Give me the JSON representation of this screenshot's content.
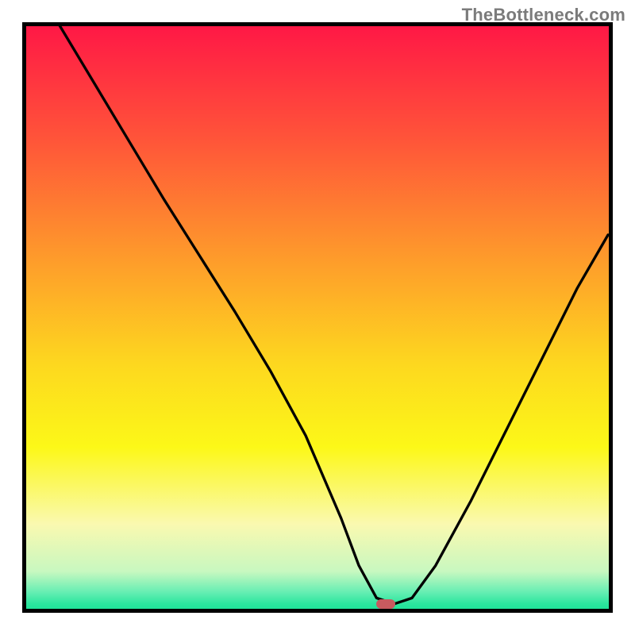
{
  "watermark": {
    "text": "TheBottleneck.com"
  },
  "colors": {
    "frame": "#000000",
    "curve": "#000000",
    "marker": "#c85a5f",
    "gradient_stops": [
      {
        "offset": 0.0,
        "color": "#ff1646"
      },
      {
        "offset": 0.2,
        "color": "#ff5539"
      },
      {
        "offset": 0.4,
        "color": "#fe9b2b"
      },
      {
        "offset": 0.58,
        "color": "#fdd81f"
      },
      {
        "offset": 0.72,
        "color": "#fcf818"
      },
      {
        "offset": 0.85,
        "color": "#faf9b0"
      },
      {
        "offset": 0.93,
        "color": "#c8f8c0"
      },
      {
        "offset": 0.965,
        "color": "#66eeb3"
      },
      {
        "offset": 0.985,
        "color": "#2be69e"
      },
      {
        "offset": 1.0,
        "color": "#18e294"
      }
    ]
  },
  "chart_data": {
    "type": "line",
    "title": "",
    "xlabel": "",
    "ylabel": "",
    "xlim": [
      0,
      100
    ],
    "ylim": [
      0,
      100
    ],
    "marker": {
      "x": 61.5,
      "y": 1.5
    },
    "series": [
      {
        "name": "curve",
        "x": [
          6,
          12,
          18,
          24,
          30,
          36,
          42,
          48,
          54,
          57,
          60,
          63,
          66,
          70,
          76,
          82,
          88,
          94,
          99.2
        ],
        "y": [
          100,
          90,
          80,
          70,
          60.5,
          51,
          41,
          30,
          16,
          8,
          2.5,
          1.5,
          2.5,
          8,
          19,
          31,
          43,
          55,
          64
        ]
      }
    ]
  }
}
